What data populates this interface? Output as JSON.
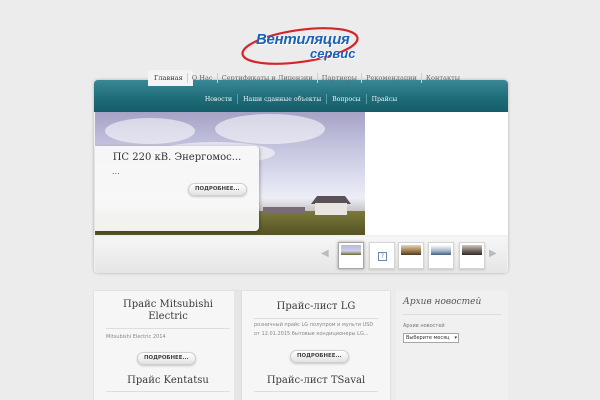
{
  "logo": {
    "line1": "Вентиляция",
    "line2": "сервис"
  },
  "top_nav": {
    "items": [
      {
        "label": "Главная",
        "active": true
      },
      {
        "label": "О Нас"
      },
      {
        "label": "Сертификаты и Лицензии"
      },
      {
        "label": "Партнеры"
      },
      {
        "label": "Рекомендации"
      },
      {
        "label": "Контакты"
      }
    ]
  },
  "sub_nav": {
    "items": [
      {
        "label": "Новости"
      },
      {
        "label": "Наши сданные объекты"
      },
      {
        "label": "Вопросы"
      },
      {
        "label": "Прайсы"
      }
    ]
  },
  "slider": {
    "caption_title": "ПС 220 кВ. Энергомос...",
    "caption_excerpt": "...",
    "more_label": "ПОДРОБНЕЕ...",
    "prev_icon": "left-arrow-icon",
    "next_icon": "right-arrow-icon"
  },
  "cards": [
    {
      "title_line1": "Прайс Mitsubishi",
      "title_line2": "Electric",
      "text_line1": "Mitsubishi Electric 2014",
      "text_line2": "",
      "more_label": "ПОДРОБНЕЕ..."
    },
    {
      "title_line1": "Прайс-лист LG",
      "title_line2": "",
      "text_line1": "розничный прайс LG полупром и мульти USD",
      "text_line2": "от 12.01.2015 бытовые кондиционеры LG...",
      "more_label": "ПОДРОБНЕЕ..."
    },
    {
      "title_line1": "Прайс Kentatsu",
      "title_line2": ""
    },
    {
      "title_line1": "Прайс-лист TSaval",
      "title_line2": ""
    }
  ],
  "sidebar": {
    "title": "Архив новостей",
    "label": "Архив новостей",
    "select_value": "Выберите месяц"
  },
  "colors": {
    "accent_teal": "#1e6d79",
    "logo_blue": "#1c62b8",
    "logo_swoosh_red": "#d3262b"
  }
}
